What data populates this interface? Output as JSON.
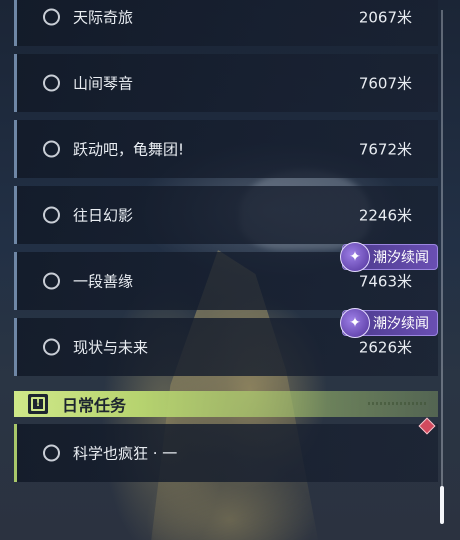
{
  "quests": [
    {
      "name": "天际奇旅",
      "distance": "2067米"
    },
    {
      "name": "山间琴音",
      "distance": "7607米"
    },
    {
      "name": "跃动吧，龟舞团!",
      "distance": "7672米"
    },
    {
      "name": "往日幻影",
      "distance": "2246米"
    },
    {
      "name": "一段善缘",
      "distance": "7463米"
    },
    {
      "name": "现状与未来",
      "distance": "2626米"
    }
  ],
  "badges": [
    {
      "label": "潮汐续闻",
      "icon": "tidal-sequel-icon"
    },
    {
      "label": "潮汐续闻",
      "icon": "tidal-sequel-icon"
    }
  ],
  "daily_section": {
    "title": "日常任务",
    "icon": "exclamation-icon",
    "quests": [
      {
        "name": "科学也疯狂 · 一"
      }
    ]
  },
  "colors": {
    "quest_accent": "#6f87a6",
    "daily_accent": "#a9c86a",
    "badge_purple": "#5b44a6",
    "marker_red": "#d24a5e"
  }
}
